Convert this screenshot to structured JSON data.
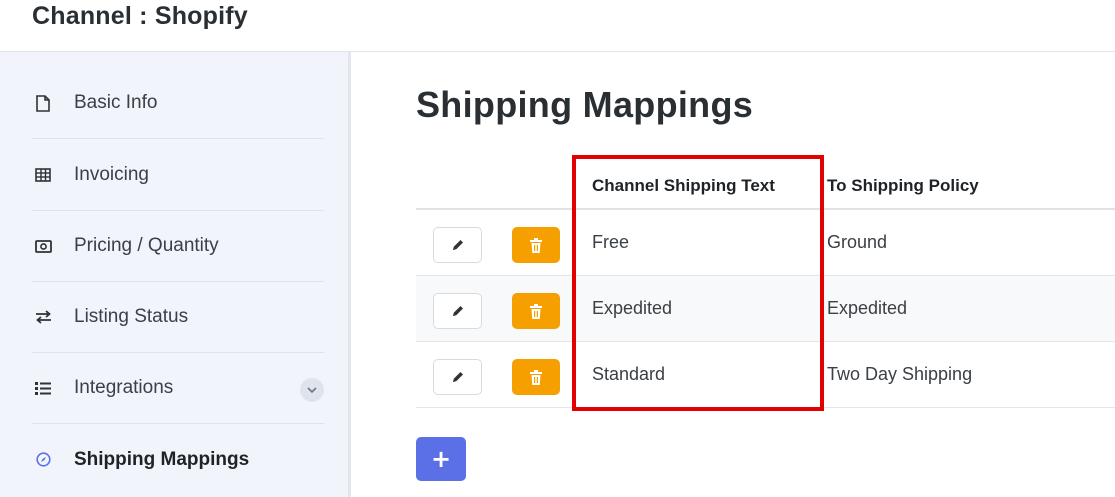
{
  "header": {
    "title": "Channel : Shopify"
  },
  "sidebar": {
    "items": [
      {
        "label": "Basic Info",
        "icon": "file-icon"
      },
      {
        "label": "Invoicing",
        "icon": "table-icon"
      },
      {
        "label": "Pricing / Quantity",
        "icon": "money-icon"
      },
      {
        "label": "Listing Status",
        "icon": "exchange-icon"
      },
      {
        "label": "Integrations",
        "icon": "list-icon",
        "expandable": true
      },
      {
        "label": "Shipping Mappings",
        "icon": "compass-icon",
        "active": true
      }
    ]
  },
  "main": {
    "title": "Shipping Mappings",
    "table": {
      "columns": [
        "Channel Shipping Text",
        "To Shipping Policy"
      ],
      "rows": [
        {
          "channel_text": "Free",
          "policy": "Ground"
        },
        {
          "channel_text": "Expedited",
          "policy": "Expedited"
        },
        {
          "channel_text": "Standard",
          "policy": "Two Day Shipping"
        }
      ]
    },
    "add_label": "+"
  },
  "colors": {
    "sidebar_bg": "#f1f5fb",
    "delete_button": "#f5a000",
    "add_button": "#5b6fe6",
    "highlight_box": "#e20000"
  }
}
